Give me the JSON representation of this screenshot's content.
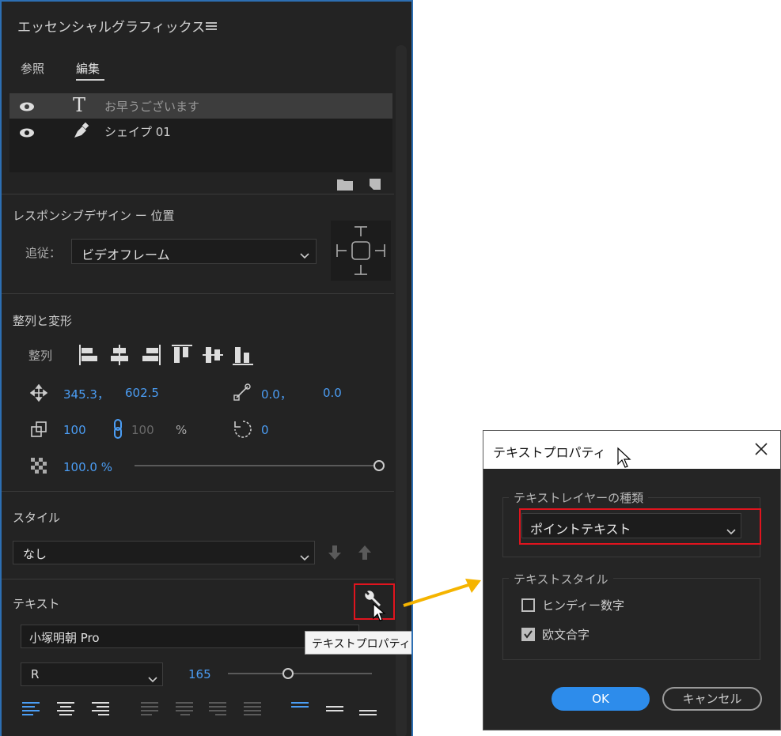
{
  "panel": {
    "title": "エッセンシャルグラフィックス",
    "tabs": [
      {
        "label": "参照"
      },
      {
        "label": "編集"
      }
    ],
    "layers": [
      {
        "name": "お早うございます"
      },
      {
        "name": "シェイプ 01"
      }
    ],
    "responsive": {
      "heading": "レスポンシブデザイン ー 位置",
      "follow_label": "追従：",
      "follow_value": "ビデオフレーム"
    },
    "align": {
      "heading": "整列と変形",
      "align_label": "整列",
      "pos_x": "345.3，",
      "pos_y": "602.5",
      "anchor_x": "0.0，",
      "anchor_y": "0.0",
      "scale": "100",
      "scale2": "100",
      "percent": "%",
      "rotation": "0",
      "opacity": "100.0 %"
    },
    "style": {
      "heading": "スタイル",
      "value": "なし"
    },
    "text": {
      "heading": "テキスト",
      "font": "小塚明朝 Pro",
      "weight": "R",
      "size": "165",
      "tooltip": "テキストプロパティ"
    }
  },
  "dialog": {
    "title": "テキストプロパティ",
    "layer_type_group": "テキストレイヤーの種類",
    "layer_type_value": "ポイントテキスト",
    "style_group": "テキストスタイル",
    "checkbox1": {
      "label": "ヒンディー数字",
      "checked": false
    },
    "checkbox2": {
      "label": "欧文合字",
      "checked": true
    },
    "ok": "OK",
    "cancel": "キャンセル"
  },
  "colors": {
    "accent": "#4b9df4",
    "highlight": "#e0141e",
    "arrow": "#f5b400",
    "ok": "#2d8ceb"
  }
}
